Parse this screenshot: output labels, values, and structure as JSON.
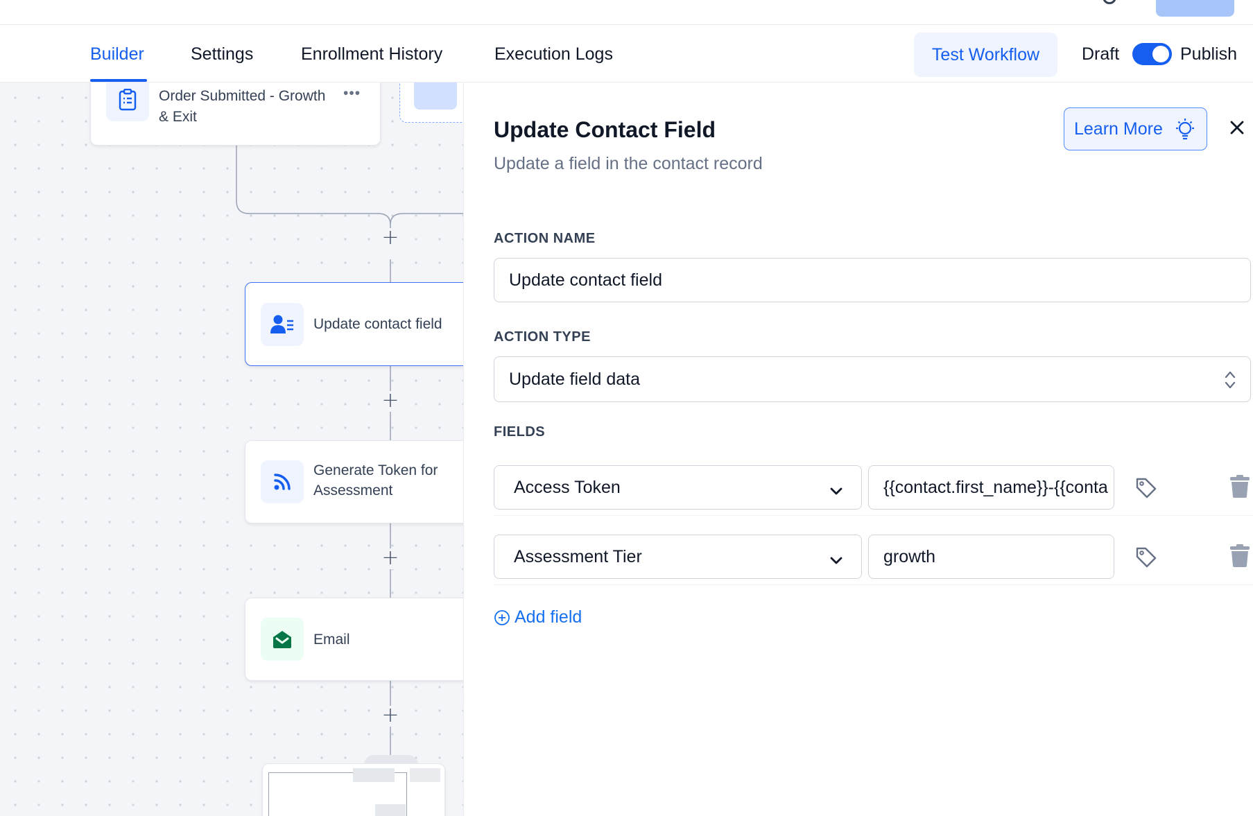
{
  "tabs": [
    {
      "label": "Builder",
      "active": true
    },
    {
      "label": "Settings",
      "active": false
    },
    {
      "label": "Enrollment History",
      "active": false
    },
    {
      "label": "Execution Logs",
      "active": false
    }
  ],
  "header": {
    "test_workflow_label": "Test Workflow",
    "draft_label": "Draft",
    "publish_label": "Publish",
    "publish_toggle_on": true
  },
  "canvas": {
    "trigger_node": {
      "label_line1": "Order Submitted - Growth",
      "label_line2": "& Exit",
      "menu_glyph": "•••",
      "icon": "clipboard-list-icon"
    },
    "nodes": [
      {
        "label": "Update contact field",
        "icon": "contact-card-icon",
        "icon_color": "#155eef",
        "selected": true
      },
      {
        "label_line1": "Generate Token for",
        "label_line2": "Assessment",
        "icon": "webhook-rss-icon",
        "icon_color": "#155eef"
      },
      {
        "label": "Email",
        "icon": "envelope-open-icon",
        "icon_color": "#067647"
      }
    ],
    "add_step_glyph": "+"
  },
  "panel": {
    "title": "Update Contact Field",
    "subtitle": "Update a field in the contact record",
    "learn_more_label": "Learn More",
    "action_name_label": "ACTION NAME",
    "action_name_value": "Update contact field",
    "action_type_label": "ACTION TYPE",
    "action_type_value": "Update field data",
    "fields_label": "FIELDS",
    "fields": [
      {
        "field": "Access Token",
        "value": "{{contact.first_name}}-{{conta"
      },
      {
        "field": "Assessment Tier",
        "value": "growth"
      }
    ],
    "add_field_label": "Add field"
  },
  "colors": {
    "accent": "#155eef",
    "canvas_bg": "#f4f5f8",
    "email_icon": "#067647"
  }
}
